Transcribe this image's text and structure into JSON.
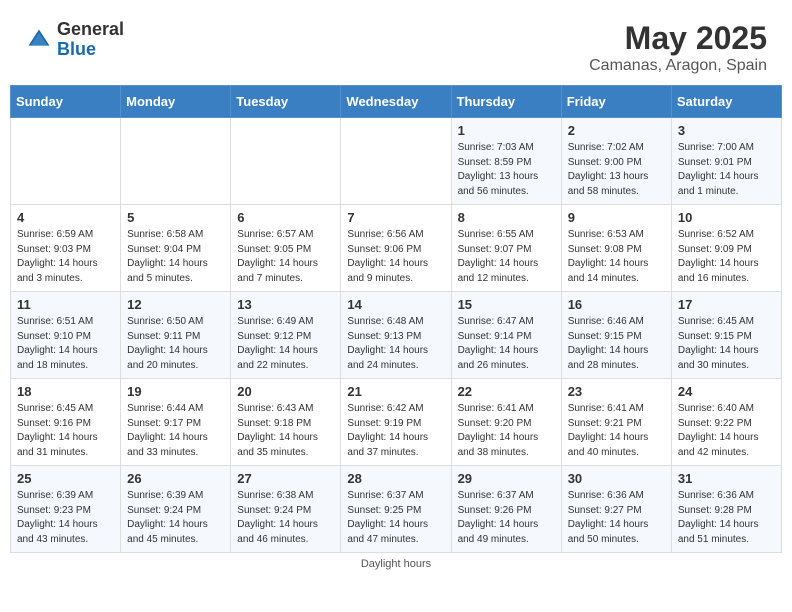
{
  "header": {
    "logo_general": "General",
    "logo_blue": "Blue",
    "title": "May 2025",
    "subtitle": "Camanas, Aragon, Spain"
  },
  "days_of_week": [
    "Sunday",
    "Monday",
    "Tuesday",
    "Wednesday",
    "Thursday",
    "Friday",
    "Saturday"
  ],
  "weeks": [
    [
      {
        "day": "",
        "info": ""
      },
      {
        "day": "",
        "info": ""
      },
      {
        "day": "",
        "info": ""
      },
      {
        "day": "",
        "info": ""
      },
      {
        "day": "1",
        "info": "Sunrise: 7:03 AM\nSunset: 8:59 PM\nDaylight: 13 hours\nand 56 minutes."
      },
      {
        "day": "2",
        "info": "Sunrise: 7:02 AM\nSunset: 9:00 PM\nDaylight: 13 hours\nand 58 minutes."
      },
      {
        "day": "3",
        "info": "Sunrise: 7:00 AM\nSunset: 9:01 PM\nDaylight: 14 hours\nand 1 minute."
      }
    ],
    [
      {
        "day": "4",
        "info": "Sunrise: 6:59 AM\nSunset: 9:03 PM\nDaylight: 14 hours\nand 3 minutes."
      },
      {
        "day": "5",
        "info": "Sunrise: 6:58 AM\nSunset: 9:04 PM\nDaylight: 14 hours\nand 5 minutes."
      },
      {
        "day": "6",
        "info": "Sunrise: 6:57 AM\nSunset: 9:05 PM\nDaylight: 14 hours\nand 7 minutes."
      },
      {
        "day": "7",
        "info": "Sunrise: 6:56 AM\nSunset: 9:06 PM\nDaylight: 14 hours\nand 9 minutes."
      },
      {
        "day": "8",
        "info": "Sunrise: 6:55 AM\nSunset: 9:07 PM\nDaylight: 14 hours\nand 12 minutes."
      },
      {
        "day": "9",
        "info": "Sunrise: 6:53 AM\nSunset: 9:08 PM\nDaylight: 14 hours\nand 14 minutes."
      },
      {
        "day": "10",
        "info": "Sunrise: 6:52 AM\nSunset: 9:09 PM\nDaylight: 14 hours\nand 16 minutes."
      }
    ],
    [
      {
        "day": "11",
        "info": "Sunrise: 6:51 AM\nSunset: 9:10 PM\nDaylight: 14 hours\nand 18 minutes."
      },
      {
        "day": "12",
        "info": "Sunrise: 6:50 AM\nSunset: 9:11 PM\nDaylight: 14 hours\nand 20 minutes."
      },
      {
        "day": "13",
        "info": "Sunrise: 6:49 AM\nSunset: 9:12 PM\nDaylight: 14 hours\nand 22 minutes."
      },
      {
        "day": "14",
        "info": "Sunrise: 6:48 AM\nSunset: 9:13 PM\nDaylight: 14 hours\nand 24 minutes."
      },
      {
        "day": "15",
        "info": "Sunrise: 6:47 AM\nSunset: 9:14 PM\nDaylight: 14 hours\nand 26 minutes."
      },
      {
        "day": "16",
        "info": "Sunrise: 6:46 AM\nSunset: 9:15 PM\nDaylight: 14 hours\nand 28 minutes."
      },
      {
        "day": "17",
        "info": "Sunrise: 6:45 AM\nSunset: 9:15 PM\nDaylight: 14 hours\nand 30 minutes."
      }
    ],
    [
      {
        "day": "18",
        "info": "Sunrise: 6:45 AM\nSunset: 9:16 PM\nDaylight: 14 hours\nand 31 minutes."
      },
      {
        "day": "19",
        "info": "Sunrise: 6:44 AM\nSunset: 9:17 PM\nDaylight: 14 hours\nand 33 minutes."
      },
      {
        "day": "20",
        "info": "Sunrise: 6:43 AM\nSunset: 9:18 PM\nDaylight: 14 hours\nand 35 minutes."
      },
      {
        "day": "21",
        "info": "Sunrise: 6:42 AM\nSunset: 9:19 PM\nDaylight: 14 hours\nand 37 minutes."
      },
      {
        "day": "22",
        "info": "Sunrise: 6:41 AM\nSunset: 9:20 PM\nDaylight: 14 hours\nand 38 minutes."
      },
      {
        "day": "23",
        "info": "Sunrise: 6:41 AM\nSunset: 9:21 PM\nDaylight: 14 hours\nand 40 minutes."
      },
      {
        "day": "24",
        "info": "Sunrise: 6:40 AM\nSunset: 9:22 PM\nDaylight: 14 hours\nand 42 minutes."
      }
    ],
    [
      {
        "day": "25",
        "info": "Sunrise: 6:39 AM\nSunset: 9:23 PM\nDaylight: 14 hours\nand 43 minutes."
      },
      {
        "day": "26",
        "info": "Sunrise: 6:39 AM\nSunset: 9:24 PM\nDaylight: 14 hours\nand 45 minutes."
      },
      {
        "day": "27",
        "info": "Sunrise: 6:38 AM\nSunset: 9:24 PM\nDaylight: 14 hours\nand 46 minutes."
      },
      {
        "day": "28",
        "info": "Sunrise: 6:37 AM\nSunset: 9:25 PM\nDaylight: 14 hours\nand 47 minutes."
      },
      {
        "day": "29",
        "info": "Sunrise: 6:37 AM\nSunset: 9:26 PM\nDaylight: 14 hours\nand 49 minutes."
      },
      {
        "day": "30",
        "info": "Sunrise: 6:36 AM\nSunset: 9:27 PM\nDaylight: 14 hours\nand 50 minutes."
      },
      {
        "day": "31",
        "info": "Sunrise: 6:36 AM\nSunset: 9:28 PM\nDaylight: 14 hours\nand 51 minutes."
      }
    ]
  ],
  "footer": "Daylight hours"
}
